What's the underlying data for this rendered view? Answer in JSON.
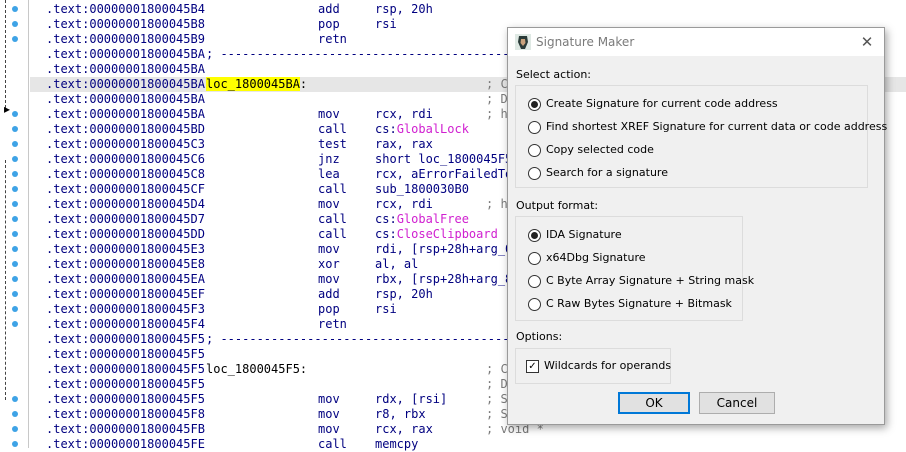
{
  "listing": {
    "rows": [
      {
        "addr": ".text:00000001800045B4",
        "label": "",
        "mnem": "add",
        "ops": "rsp, 20h",
        "comment": ""
      },
      {
        "addr": ".text:00000001800045B8",
        "label": "",
        "mnem": "pop",
        "ops": "rsi",
        "comment": ""
      },
      {
        "addr": ".text:00000001800045B9",
        "label": "",
        "mnem": "retn",
        "ops": "",
        "comment": ""
      },
      {
        "addr": ".text:00000001800045BA",
        "label": "; ---------------------------------------------------------------",
        "mnem": "",
        "ops": "",
        "comment": ""
      },
      {
        "addr": ".text:00000001800045BA",
        "label": "",
        "mnem": "",
        "ops": "",
        "comment": ""
      },
      {
        "addr": ".text:00000001800045BA",
        "label": "loc_1800045BA:",
        "mnem": "",
        "ops": "",
        "comment": "; C"
      },
      {
        "addr": ".text:00000001800045BA",
        "label": "",
        "mnem": "",
        "ops": "",
        "comment": "; D"
      },
      {
        "addr": ".text:00000001800045BA",
        "label": "",
        "mnem": "mov",
        "ops": "rcx, rdi",
        "comment": "; h"
      },
      {
        "addr": ".text:00000001800045BD",
        "label": "",
        "mnem": "call",
        "ops": "cs:GlobalLock",
        "comment": ""
      },
      {
        "addr": ".text:00000001800045C3",
        "label": "",
        "mnem": "test",
        "ops": "rax, rax",
        "comment": ""
      },
      {
        "addr": ".text:00000001800045C6",
        "label": "",
        "mnem": "jnz",
        "ops": "short loc_1800045F5",
        "comment": ""
      },
      {
        "addr": ".text:00000001800045C8",
        "label": "",
        "mnem": "lea",
        "ops": "rcx, aErrorFailedTo",
        "comment": ""
      },
      {
        "addr": ".text:00000001800045CF",
        "label": "",
        "mnem": "call",
        "ops": "sub_1800030B0",
        "comment": ""
      },
      {
        "addr": ".text:00000001800045D4",
        "label": "",
        "mnem": "mov",
        "ops": "rcx, rdi",
        "comment": "; h"
      },
      {
        "addr": ".text:00000001800045D7",
        "label": "",
        "mnem": "call",
        "ops": "cs:GlobalFree",
        "comment": ""
      },
      {
        "addr": ".text:00000001800045DD",
        "label": "",
        "mnem": "call",
        "ops": "cs:CloseClipboard",
        "comment": ""
      },
      {
        "addr": ".text:00000001800045E3",
        "label": "",
        "mnem": "mov",
        "ops": "rdi, [rsp+28h+arg_0",
        "comment": ""
      },
      {
        "addr": ".text:00000001800045E8",
        "label": "",
        "mnem": "xor",
        "ops": "al, al",
        "comment": ""
      },
      {
        "addr": ".text:00000001800045EA",
        "label": "",
        "mnem": "mov",
        "ops": "rbx, [rsp+28h+arg_8",
        "comment": ""
      },
      {
        "addr": ".text:00000001800045EF",
        "label": "",
        "mnem": "add",
        "ops": "rsp, 20h",
        "comment": ""
      },
      {
        "addr": ".text:00000001800045F3",
        "label": "",
        "mnem": "pop",
        "ops": "rsi",
        "comment": ""
      },
      {
        "addr": ".text:00000001800045F4",
        "label": "",
        "mnem": "retn",
        "ops": "",
        "comment": ""
      },
      {
        "addr": ".text:00000001800045F5",
        "label": "; ---------------------------------------------------------------",
        "mnem": "",
        "ops": "",
        "comment": ""
      },
      {
        "addr": ".text:00000001800045F5",
        "label": "",
        "mnem": "",
        "ops": "",
        "comment": ""
      },
      {
        "addr": ".text:00000001800045F5",
        "label": "loc_1800045F5:",
        "mnem": "",
        "ops": "",
        "comment": "; C"
      },
      {
        "addr": ".text:00000001800045F5",
        "label": "",
        "mnem": "",
        "ops": "",
        "comment": "; D"
      },
      {
        "addr": ".text:00000001800045F5",
        "label": "",
        "mnem": "mov",
        "ops": "rdx, [rsi]",
        "comment": "; S"
      },
      {
        "addr": ".text:00000001800045F8",
        "label": "",
        "mnem": "mov",
        "ops": "r8, rbx",
        "comment": "; S"
      },
      {
        "addr": ".text:00000001800045FB",
        "label": "",
        "mnem": "mov",
        "ops": "rcx, rax",
        "comment": "; void *"
      },
      {
        "addr": ".text:00000001800045FE",
        "label": "",
        "mnem": "call",
        "ops": "memcpy",
        "comment": ""
      }
    ]
  },
  "dialog": {
    "title": "Signature Maker",
    "close_glyph": "✕",
    "select_action": {
      "heading": "Select action:",
      "options": [
        {
          "label": "Create Signature for current code address",
          "selected": true
        },
        {
          "label": "Find shortest XREF Signature for current data or code address",
          "selected": false
        },
        {
          "label": "Copy selected code",
          "selected": false
        },
        {
          "label": "Search for a signature",
          "selected": false
        }
      ]
    },
    "output_format": {
      "heading": "Output format:",
      "options": [
        {
          "label": "IDA Signature",
          "selected": true
        },
        {
          "label": "x64Dbg Signature",
          "selected": false
        },
        {
          "label": "C Byte Array Signature + String mask",
          "selected": false
        },
        {
          "label": "C Raw Bytes Signature + Bitmask",
          "selected": false
        }
      ]
    },
    "options": {
      "heading": "Options:",
      "wildcards_label": "Wildcards for operands",
      "wildcards_checked": true,
      "check_glyph": "✓"
    },
    "ok_label": "OK",
    "cancel_label": "Cancel"
  },
  "colors": {
    "addr": "#000080",
    "label_highlight": "#ffff00",
    "row_highlight": "#e6e6e6",
    "import_func": "#d020d0",
    "breakpoint_dot": "#3ea3e6"
  }
}
